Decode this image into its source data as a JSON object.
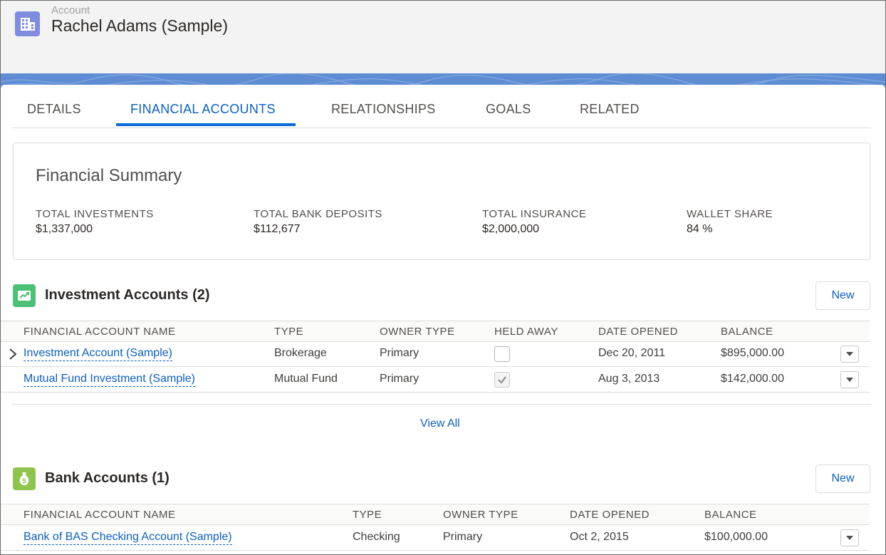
{
  "header": {
    "eyebrow": "Account",
    "title": "Rachel Adams (Sample)",
    "icon": "building-icon"
  },
  "tabs": [
    {
      "label": "DETAILS",
      "active": false
    },
    {
      "label": "FINANCIAL ACCOUNTS",
      "active": true
    },
    {
      "label": "RELATIONSHIPS",
      "active": false
    },
    {
      "label": "GOALS",
      "active": false
    },
    {
      "label": "RELATED",
      "active": false
    }
  ],
  "summary": {
    "title": "Financial Summary",
    "metrics": [
      {
        "label": "TOTAL INVESTMENTS",
        "value": "$1,337,000"
      },
      {
        "label": "TOTAL BANK DEPOSITS",
        "value": "$112,677"
      },
      {
        "label": "TOTAL INSURANCE",
        "value": "$2,000,000"
      },
      {
        "label": "WALLET SHARE",
        "value": "84 %"
      }
    ]
  },
  "investments": {
    "title": "Investment Accounts (2)",
    "icon": "trend-up-icon",
    "icon_color": "#4bc076",
    "new_label": "New",
    "columns": [
      "FINANCIAL ACCOUNT NAME",
      "TYPE",
      "OWNER TYPE",
      "HELD AWAY",
      "DATE OPENED",
      "BALANCE"
    ],
    "rows": [
      {
        "name": "Investment Account (Sample)",
        "type": "Brokerage",
        "owner": "Primary",
        "held_away": false,
        "date": "Dec 20, 2011",
        "balance": "$895,000.00"
      },
      {
        "name": "Mutual Fund Investment (Sample)",
        "type": "Mutual Fund",
        "owner": "Primary",
        "held_away": true,
        "date": "Aug 3, 2013",
        "balance": "$142,000.00"
      }
    ],
    "view_all": "View All"
  },
  "bank": {
    "title": "Bank Accounts (1)",
    "icon": "money-bag-icon",
    "icon_color": "#91c44f",
    "new_label": "New",
    "columns": [
      "FINANCIAL ACCOUNT NAME",
      "TYPE",
      "OWNER TYPE",
      "DATE OPENED",
      "BALANCE"
    ],
    "rows": [
      {
        "name": "Bank of BAS Checking Account (Sample)",
        "type": "Checking",
        "owner": "Primary",
        "date": "Oct 2, 2015",
        "balance": "$100,000.00"
      }
    ]
  },
  "colors": {
    "brand_link": "#0b5fc4",
    "tab_underline": "#0b6bd6",
    "band": "#5f8dd3",
    "header_icon": "#7f8de1"
  }
}
